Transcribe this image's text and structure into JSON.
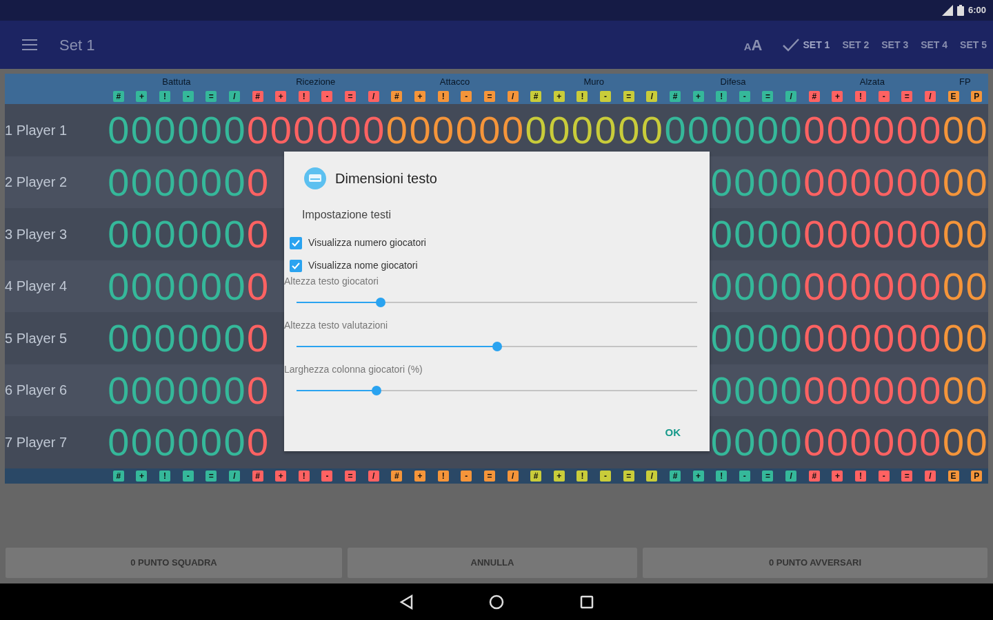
{
  "status_bar": {
    "time": "6:00"
  },
  "app_bar": {
    "title": "Set 1",
    "text_size_button": "AA",
    "tabs": [
      {
        "label": "SET 1",
        "selected": true
      },
      {
        "label": "SET 2",
        "selected": false
      },
      {
        "label": "SET 3",
        "selected": false
      },
      {
        "label": "SET 4",
        "selected": false
      },
      {
        "label": "SET 5",
        "selected": false
      }
    ]
  },
  "table": {
    "groups": [
      {
        "name": "Battuta",
        "color": "#35b89a",
        "symbols": [
          "#",
          "+",
          "!",
          "-",
          "=",
          "/"
        ],
        "footer_symbols": [
          "#",
          "+",
          "!",
          "-",
          "=",
          "/"
        ]
      },
      {
        "name": "Ricezione",
        "color": "#ff6262",
        "symbols": [
          "#",
          "+",
          "!",
          "-",
          "=",
          "/"
        ],
        "footer_symbols": [
          "#",
          "+",
          "!",
          "-",
          "=",
          "/"
        ]
      },
      {
        "name": "Attacco",
        "color": "#f5953a",
        "symbols": [
          "#",
          "+",
          "!",
          "-",
          "=",
          "/"
        ],
        "footer_symbols": [
          "#",
          "+",
          "!",
          "-",
          "=",
          "/"
        ]
      },
      {
        "name": "Muro",
        "color": "#c9cc3a",
        "symbols": [
          "#",
          "+",
          "!",
          "-",
          "=",
          "/"
        ],
        "footer_symbols": [
          "#",
          "+",
          "!",
          "-",
          "=",
          "/"
        ]
      },
      {
        "name": "Difesa",
        "color": "#35b89a",
        "symbols": [
          "#",
          "+",
          "!",
          "-",
          "=",
          "/"
        ],
        "footer_symbols": [
          "#",
          "+",
          "!",
          "-",
          "=",
          "/"
        ]
      },
      {
        "name": "Alzata",
        "color": "#ff6262",
        "symbols": [
          "#",
          "+",
          "!",
          "-",
          "=",
          "/"
        ],
        "footer_symbols": [
          "#",
          "+",
          "!",
          "-",
          "=",
          "/"
        ]
      },
      {
        "name": "FP",
        "color": "#f5953a",
        "symbols": [
          "E",
          "P"
        ],
        "footer_symbols": [
          "E",
          "P"
        ]
      }
    ],
    "rows": [
      {
        "label": "1 Player 1",
        "values_before": [
          "0",
          "0",
          "0",
          "0",
          "0",
          "0",
          "0",
          "0",
          "0",
          "0",
          "0",
          "0",
          "0",
          "0",
          "0",
          "0",
          "0",
          "0",
          "0",
          "0",
          "0",
          "0",
          "0",
          "0",
          "0",
          "0",
          "0",
          "0",
          "0",
          "0",
          "0",
          "0",
          "0",
          "0",
          "0",
          "0",
          "0",
          "0"
        ]
      },
      {
        "label": "2 Player 2",
        "values_before": [
          "0",
          "0",
          "0",
          "0",
          "0",
          "0",
          "0"
        ],
        "values_after": [
          "0",
          "0",
          "0",
          "0",
          "0",
          "0",
          "0",
          "0",
          "0",
          "0",
          "0",
          "0"
        ]
      },
      {
        "label": "3 Player 3",
        "values_before": [
          "0",
          "0",
          "0",
          "0",
          "0",
          "0",
          "0"
        ],
        "values_after": [
          "0",
          "0",
          "0",
          "0",
          "0",
          "0",
          "0",
          "0",
          "0",
          "0",
          "0",
          "0"
        ]
      },
      {
        "label": "4 Player 4",
        "values_before": [
          "0",
          "0",
          "0",
          "0",
          "0",
          "0",
          "0"
        ],
        "values_after": [
          "0",
          "0",
          "0",
          "0",
          "0",
          "0",
          "0",
          "0",
          "0",
          "0",
          "0",
          "0"
        ]
      },
      {
        "label": "5 Player 5",
        "values_before": [
          "0",
          "0",
          "0",
          "0",
          "0",
          "0",
          "0"
        ],
        "values_after": [
          "0",
          "0",
          "0",
          "0",
          "0",
          "0",
          "0",
          "0",
          "0",
          "0",
          "0",
          "0"
        ]
      },
      {
        "label": "6 Player 6",
        "values_before": [
          "0",
          "0",
          "0",
          "0",
          "0",
          "0",
          "0"
        ],
        "values_after": [
          "0",
          "0",
          "0",
          "0",
          "0",
          "0",
          "0",
          "0",
          "0",
          "0",
          "0",
          "0"
        ]
      },
      {
        "label": "7 Player 7",
        "values_before": [
          "0",
          "0",
          "0",
          "0",
          "0",
          "0",
          "0"
        ],
        "values_after": [
          "0",
          "0",
          "0",
          "0",
          "0",
          "0",
          "0",
          "0",
          "0",
          "0",
          "0",
          "0"
        ]
      }
    ]
  },
  "bottom_buttons": [
    "0 PUNTO SQUADRA",
    "ANNULLA",
    "0 PUNTO AVVERSARI"
  ],
  "dialog": {
    "title": "Dimensioni testo",
    "subtitle": "Impostazione testi",
    "checkboxes": [
      {
        "label": "Visualizza numero giocatori",
        "checked": true
      },
      {
        "label": "Visualizza nome giocatori",
        "checked": true
      }
    ],
    "sliders": [
      {
        "label": "Altezza testo giocatori",
        "level": 0.21
      },
      {
        "label": "Altezza testo valutazioni",
        "level": 0.5
      },
      {
        "label": "Larghezza colonna giocatori (%)",
        "level": 0.2
      }
    ],
    "ok_button": "OK"
  }
}
